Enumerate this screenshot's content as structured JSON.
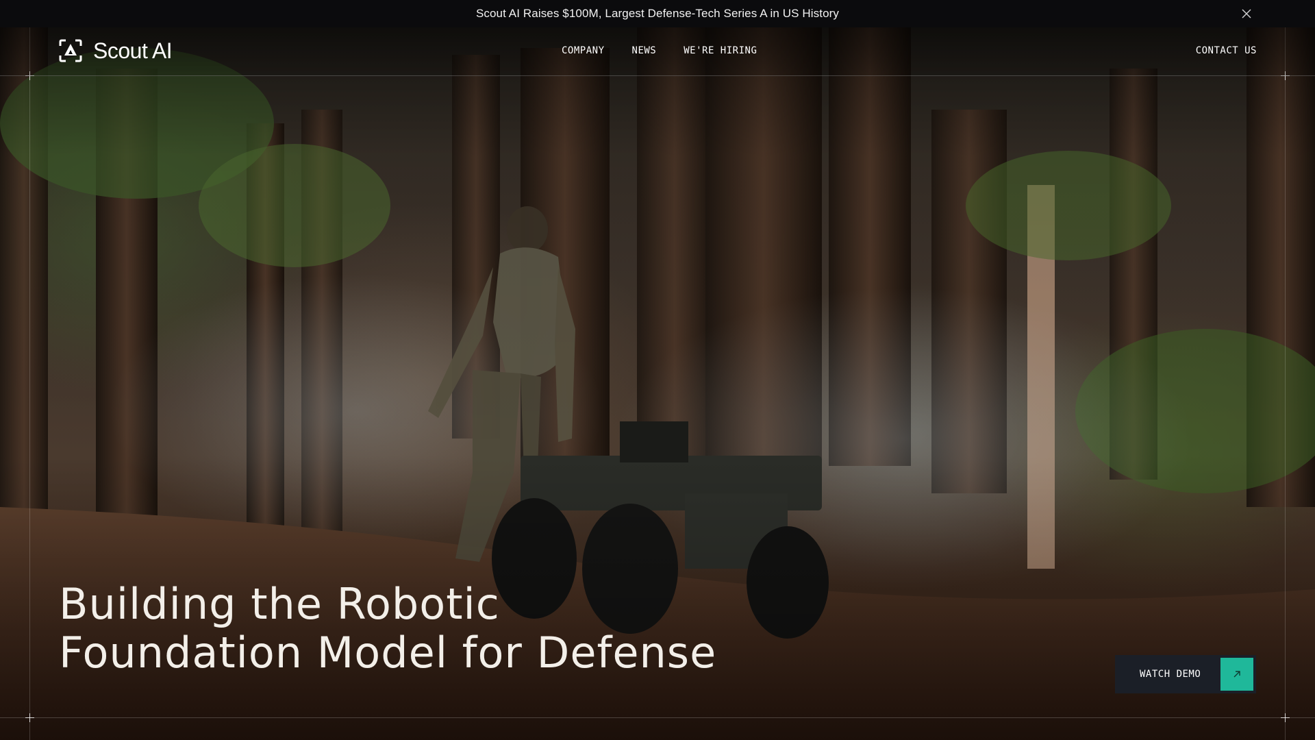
{
  "announcement": {
    "text": "Scout AI Raises $100M, Largest Defense-Tech Series A in US History",
    "close_icon": "close-icon"
  },
  "header": {
    "logo_text": "Scout AI",
    "logo_icon": "scout-logo-icon",
    "nav": [
      {
        "label": "COMPANY"
      },
      {
        "label": "NEWS"
      },
      {
        "label": "WE'RE HIRING"
      }
    ],
    "contact_label": "CONTACT US"
  },
  "hero": {
    "headline_line1": "Building the Robotic",
    "headline_line2": "Foundation Model for Defense",
    "cta_label": "WATCH DEMO",
    "cta_icon": "arrow-up-right-icon",
    "background_description_colors": {
      "accent": "#1fb89a",
      "cta_bg": "#1b1f27",
      "bar_bg": "#0b0b0d"
    }
  }
}
